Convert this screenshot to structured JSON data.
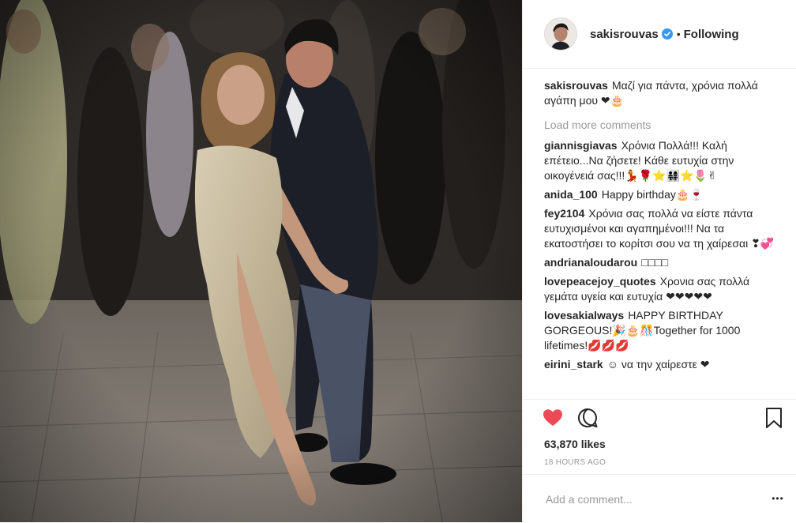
{
  "header": {
    "username": "sakisrouvas",
    "dot": "•",
    "follow_status": "Following"
  },
  "caption": {
    "user": "sakisrouvas",
    "text": "Μαζί για πάντα, χρόνια πολλά αγάπη μου ❤🎂"
  },
  "load_more": "Load more comments",
  "comments": [
    {
      "user": "giannisgiavas",
      "text": "Χρόνια Πολλά!!! Καλή επέτειο...Να ζήσετε! Κάθε ευτυχία στην οικογένειά σας!!!💃🌹⭐👨‍👩‍👧‍👧⭐🌷✌"
    },
    {
      "user": "anida_100",
      "text": "Happy birthday🎂🍷"
    },
    {
      "user": "fey2104",
      "text": "Χρόνια σας πολλά να είστε πάντα ευτυχισμένοι και αγαπημένοι!!! Να τα εκατοστήσει το κορίτσι σου να τη χαίρεσαι ❣💞"
    },
    {
      "user": "andrianaloudarou",
      "text": "□□□□"
    },
    {
      "user": "lovepeacejoy_quotes",
      "text": "Χρονια σας πολλά γεμάτα υγεία και ευτυχία ❤❤❤❤❤"
    },
    {
      "user": "lovesakialways",
      "text": "HAPPY BIRTHDAY GORGEOUS!🎉🎂🎊Together for 1000 lifetimes!💋💋💋"
    },
    {
      "user": "eirini_stark",
      "text": "☺ να την χαίρεστε ❤"
    }
  ],
  "likes": "63,870 likes",
  "timestamp": "18 HOURS AGO",
  "add_comment_placeholder": "Add a comment...",
  "more_label": "•••",
  "colors": {
    "heart_red": "#ed4956",
    "verified_blue": "#3897f0",
    "muted_gray": "#999999",
    "border": "#efefef"
  },
  "icons": [
    "heart-icon",
    "comment-icon",
    "bookmark-icon",
    "verified-icon",
    "more-icon"
  ]
}
